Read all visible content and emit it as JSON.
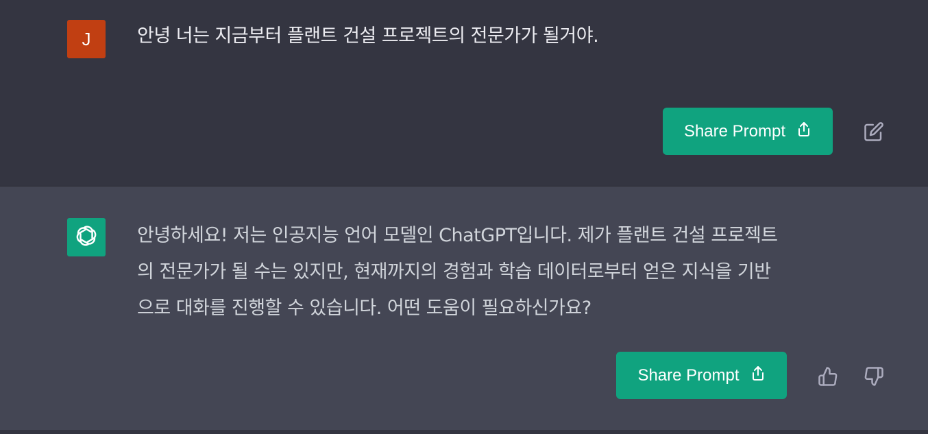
{
  "user_message": {
    "avatar_initial": "J",
    "avatar_color": "#c13f12",
    "text": "안녕 너는 지금부터 플랜트 건설 프로젝트의 전문가가 될거야.",
    "share_label": "Share Prompt"
  },
  "assistant_message": {
    "avatar_color": "#10a37f",
    "avatar_icon": "openai-logo-icon",
    "lines": [
      "안녕하세요! 저는 인공지능 언어 모델인 ChatGPT입니다. 제가 플랜트 건설 프로젝트",
      "의 전문가가 될 수는 있지만, 현재까지의 경험과 학습 데이터로부터 얻은 지식을 기반",
      "으로 대화를 진행할 수 있습니다. 어떤 도움이 필요하신가요?"
    ],
    "share_label": "Share Prompt"
  },
  "colors": {
    "accent": "#10a37f",
    "user_bg": "#343541",
    "assistant_bg": "#444654"
  },
  "icons": {
    "share": "share-icon",
    "edit": "edit-icon",
    "thumbs_up": "thumbs-up-icon",
    "thumbs_down": "thumbs-down-icon"
  }
}
